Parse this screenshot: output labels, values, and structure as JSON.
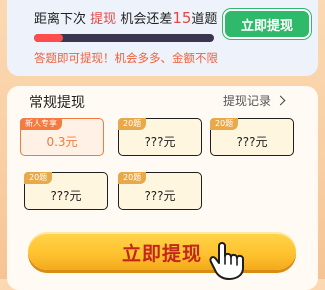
{
  "progress_card": {
    "gap_prefix": "距离下次",
    "gap_keyword": "提现",
    "gap_mid": "机会还差",
    "gap_count": "15",
    "gap_suffix": "道题",
    "progress_fraction": 0.16,
    "hint": "答题即可提现！机会多多、金额不限",
    "button_label": "立即提现"
  },
  "regular": {
    "title": "常规提现",
    "record_link": "提现记录",
    "options": [
      {
        "tag": "新人专享",
        "amount": "0.3元",
        "highlighted": true
      },
      {
        "tag": "20题",
        "amount": "???元",
        "highlighted": false
      },
      {
        "tag": "20题",
        "amount": "???元",
        "highlighted": false
      },
      {
        "tag": "20题",
        "amount": "???元",
        "highlighted": false
      },
      {
        "tag": "20题",
        "amount": "???元",
        "highlighted": false
      }
    ]
  },
  "main_button": {
    "label": "立即提现"
  },
  "colors": {
    "accent_red": "#e64545",
    "green_button": "#2fb96a",
    "gold_button": "#ffc12e",
    "hint_orange": "#f0603c"
  },
  "icons": {
    "pointer": "hand-pointer-icon",
    "record_chevron": "chevron-right-icon"
  }
}
